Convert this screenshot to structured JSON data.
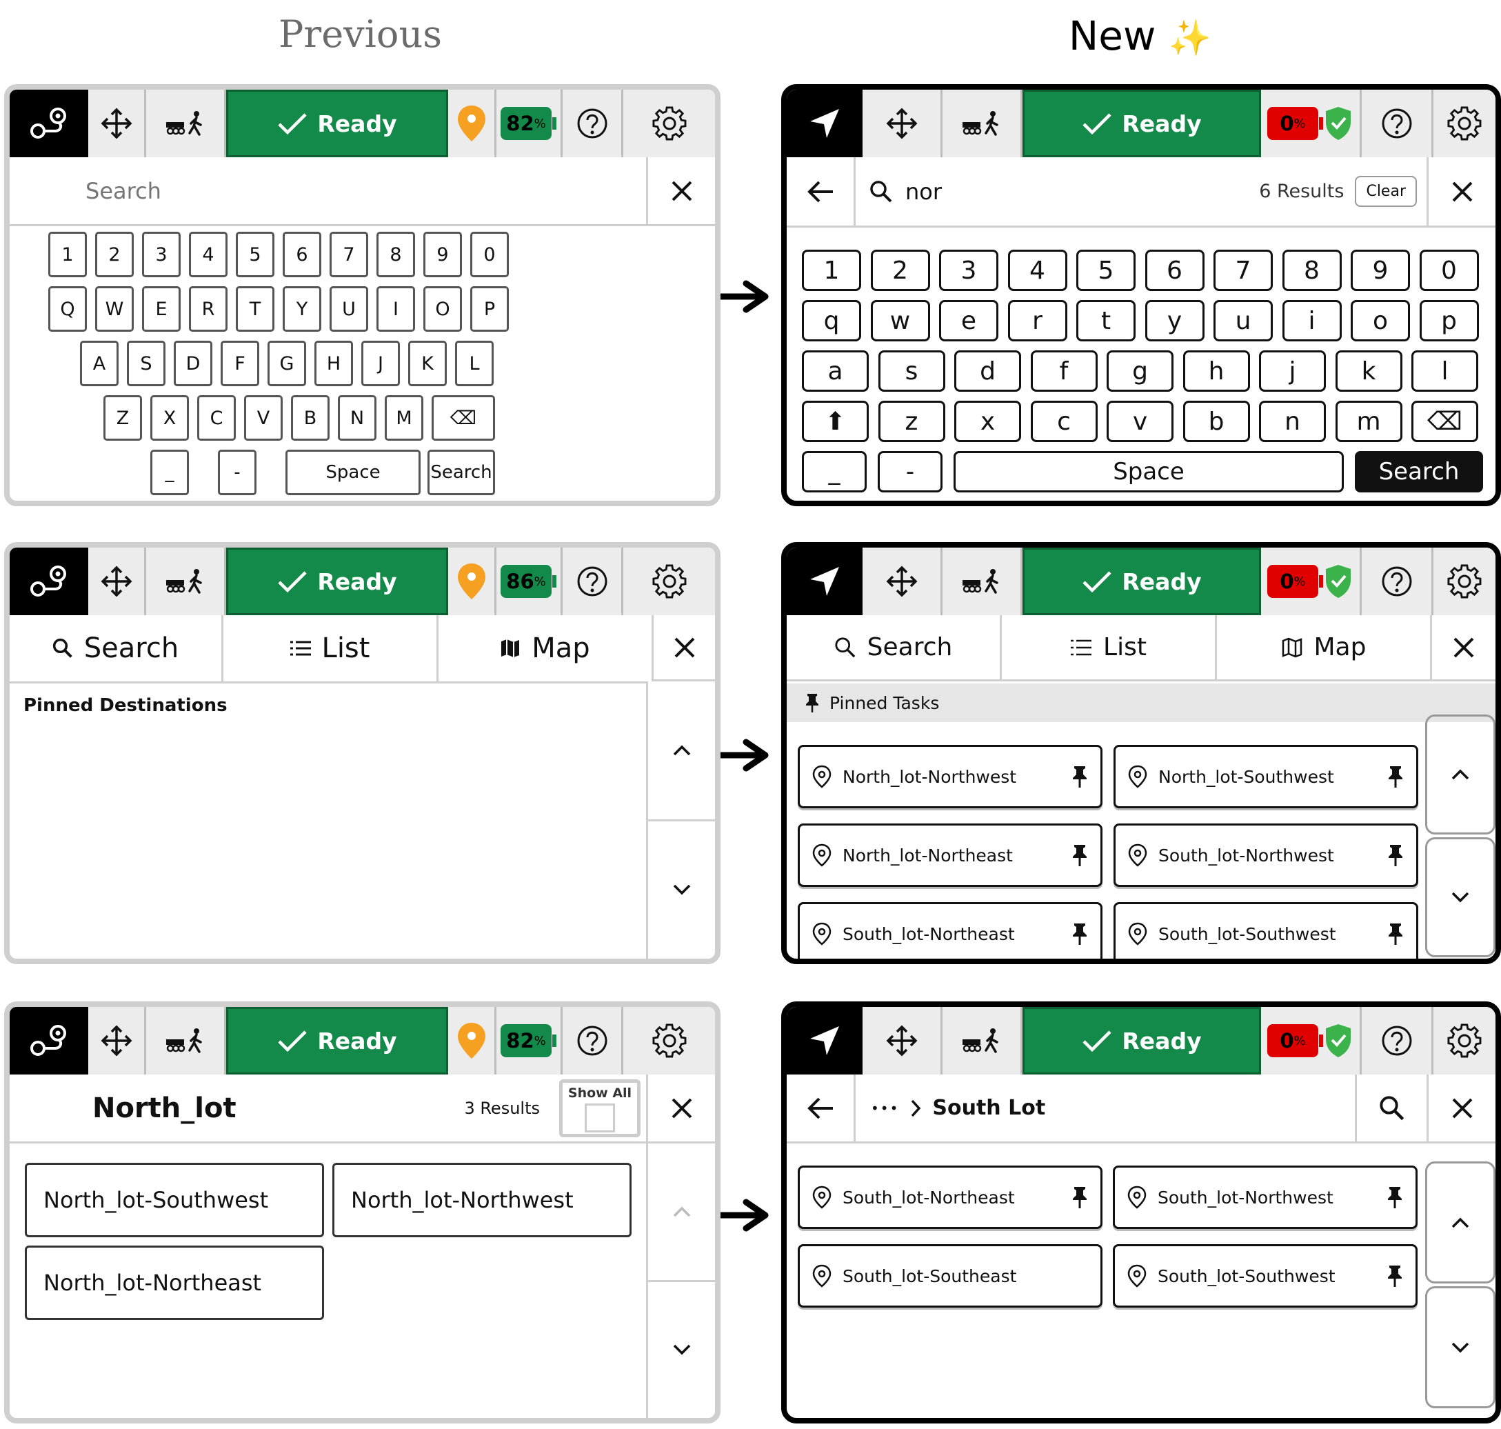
{
  "headers": {
    "previous": "Previous",
    "new": "New",
    "sparkle": "✨"
  },
  "topbar": {
    "ready_label": "Ready",
    "old_battery": [
      "82",
      "86",
      "82"
    ],
    "new_battery": "0",
    "percent": "%"
  },
  "keyboard_old": {
    "search_placeholder": "Search",
    "rows": [
      [
        "1",
        "2",
        "3",
        "4",
        "5",
        "6",
        "7",
        "8",
        "9",
        "0"
      ],
      [
        "Q",
        "W",
        "E",
        "R",
        "T",
        "Y",
        "U",
        "I",
        "O",
        "P"
      ],
      [
        "A",
        "S",
        "D",
        "F",
        "G",
        "H",
        "J",
        "K",
        "L"
      ],
      [
        "Z",
        "X",
        "C",
        "V",
        "B",
        "N",
        "M",
        "⌫"
      ]
    ],
    "bottom": [
      "_",
      "-",
      "Space",
      "Search"
    ]
  },
  "keyboard_new": {
    "query": "nor",
    "results": "6 Results",
    "clear": "Clear",
    "rows": [
      [
        "1",
        "2",
        "3",
        "4",
        "5",
        "6",
        "7",
        "8",
        "9",
        "0"
      ],
      [
        "q",
        "w",
        "e",
        "r",
        "t",
        "y",
        "u",
        "i",
        "o",
        "p"
      ],
      [
        "a",
        "s",
        "d",
        "f",
        "g",
        "h",
        "j",
        "k",
        "l"
      ],
      [
        "⬆",
        "z",
        "x",
        "c",
        "v",
        "b",
        "n",
        "m",
        "⌫"
      ]
    ],
    "bottom": [
      "_",
      "-",
      "Space",
      "Search"
    ]
  },
  "tabs": {
    "search": "Search",
    "list": "List",
    "map": "Map"
  },
  "pinned_old": {
    "heading": "Pinned Destinations"
  },
  "pinned_new": {
    "heading": "Pinned Tasks",
    "items": [
      "North_lot-Northwest",
      "North_lot-Southwest",
      "North_lot-Northeast",
      "South_lot-Northwest",
      "South_lot-Northeast",
      "South_lot-Southwest"
    ]
  },
  "list_old": {
    "title": "North_lot",
    "results": "3 Results",
    "show_all": "Show All",
    "items": [
      "North_lot-Southwest",
      "North_lot-Northwest",
      "North_lot-Northeast"
    ]
  },
  "list_new": {
    "ellipsis": "•••",
    "breadcrumb": "South Lot",
    "items": [
      "South_lot-Northeast",
      "South_lot-Northwest",
      "South_lot-Southeast",
      "South_lot-Southwest"
    ]
  },
  "colors": {
    "ready_green": "#148a4a",
    "battery_red": "#e10000",
    "pin_orange": "#f5a020",
    "shield_green": "#3cb34a"
  }
}
